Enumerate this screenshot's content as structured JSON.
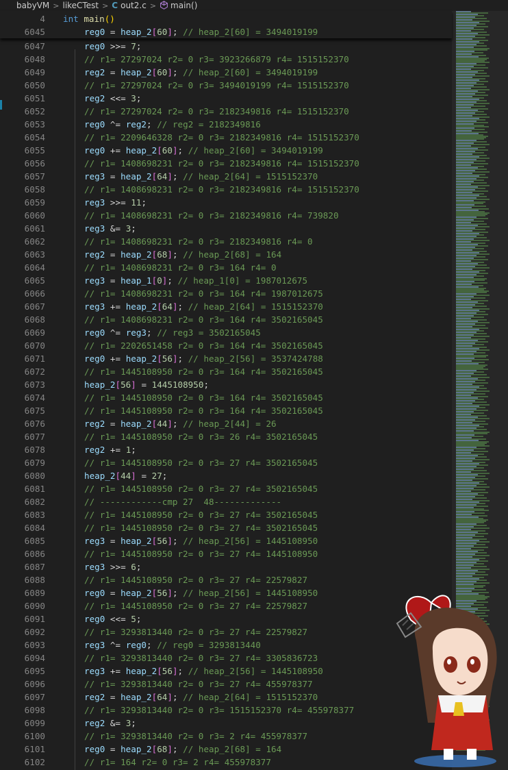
{
  "breadcrumb": {
    "items": [
      "babyVM",
      "likeCTest",
      "out2.c",
      "main()"
    ]
  },
  "sticky": [
    {
      "num": "4",
      "tokens": [
        [
          "kw",
          "int "
        ],
        [
          "fn",
          "main"
        ],
        [
          "br2",
          "()"
        ]
      ]
    },
    {
      "num": "6045",
      "tokens": [
        [
          "var",
          "reg0"
        ],
        [
          "t",
          " = "
        ],
        [
          "var",
          "heap_2"
        ],
        [
          "br",
          "["
        ],
        [
          "num",
          "60"
        ],
        [
          "br",
          "]"
        ],
        [
          "t",
          "; "
        ],
        [
          "cm",
          "// heap_2[60] = 3494019199"
        ]
      ]
    }
  ],
  "lines": [
    {
      "num": "6047",
      "tokens": [
        [
          "var",
          "reg0"
        ],
        [
          "t",
          " >>= "
        ],
        [
          "num",
          "7"
        ],
        [
          "t",
          ";"
        ]
      ]
    },
    {
      "num": "6048",
      "tokens": [
        [
          "cm",
          "// r1= 27297024 r2= 0 r3= 3923266879 r4= 1515152370"
        ]
      ]
    },
    {
      "num": "6049",
      "tokens": [
        [
          "var",
          "reg2"
        ],
        [
          "t",
          " = "
        ],
        [
          "var",
          "heap_2"
        ],
        [
          "br",
          "["
        ],
        [
          "num",
          "60"
        ],
        [
          "br",
          "]"
        ],
        [
          "t",
          "; "
        ],
        [
          "cm",
          "// heap_2[60] = 3494019199"
        ]
      ]
    },
    {
      "num": "6050",
      "tokens": [
        [
          "cm",
          "// r1= 27297024 r2= 0 r3= 3494019199 r4= 1515152370"
        ]
      ]
    },
    {
      "num": "6051",
      "tokens": [
        [
          "var",
          "reg2"
        ],
        [
          "t",
          " <<= "
        ],
        [
          "num",
          "3"
        ],
        [
          "t",
          ";"
        ]
      ]
    },
    {
      "num": "6052",
      "tokens": [
        [
          "cm",
          "// r1= 27297024 r2= 0 r3= 2182349816 r4= 1515152370"
        ]
      ]
    },
    {
      "num": "6053",
      "tokens": [
        [
          "var",
          "reg0"
        ],
        [
          "t",
          " ^= "
        ],
        [
          "var",
          "reg2"
        ],
        [
          "t",
          "; "
        ],
        [
          "cm",
          "// reg2 = 2182349816"
        ]
      ]
    },
    {
      "num": "6054",
      "tokens": [
        [
          "cm",
          "// r1= 2209646328 r2= 0 r3= 2182349816 r4= 1515152370"
        ]
      ]
    },
    {
      "num": "6055",
      "tokens": [
        [
          "var",
          "reg0"
        ],
        [
          "t",
          " += "
        ],
        [
          "var",
          "heap_2"
        ],
        [
          "br",
          "["
        ],
        [
          "num",
          "60"
        ],
        [
          "br",
          "]"
        ],
        [
          "t",
          "; "
        ],
        [
          "cm",
          "// heap_2[60] = 3494019199"
        ]
      ]
    },
    {
      "num": "6056",
      "tokens": [
        [
          "cm",
          "// r1= 1408698231 r2= 0 r3= 2182349816 r4= 1515152370"
        ]
      ]
    },
    {
      "num": "6057",
      "tokens": [
        [
          "var",
          "reg3"
        ],
        [
          "t",
          " = "
        ],
        [
          "var",
          "heap_2"
        ],
        [
          "br",
          "["
        ],
        [
          "num",
          "64"
        ],
        [
          "br",
          "]"
        ],
        [
          "t",
          "; "
        ],
        [
          "cm",
          "// heap_2[64] = 1515152370"
        ]
      ]
    },
    {
      "num": "6058",
      "tokens": [
        [
          "cm",
          "// r1= 1408698231 r2= 0 r3= 2182349816 r4= 1515152370"
        ]
      ]
    },
    {
      "num": "6059",
      "tokens": [
        [
          "var",
          "reg3"
        ],
        [
          "t",
          " >>= "
        ],
        [
          "num",
          "11"
        ],
        [
          "t",
          ";"
        ]
      ]
    },
    {
      "num": "6060",
      "tokens": [
        [
          "cm",
          "// r1= 1408698231 r2= 0 r3= 2182349816 r4= 739820"
        ]
      ]
    },
    {
      "num": "6061",
      "tokens": [
        [
          "var",
          "reg3"
        ],
        [
          "t",
          " &= "
        ],
        [
          "num",
          "3"
        ],
        [
          "t",
          ";"
        ]
      ]
    },
    {
      "num": "6062",
      "tokens": [
        [
          "cm",
          "// r1= 1408698231 r2= 0 r3= 2182349816 r4= 0"
        ]
      ]
    },
    {
      "num": "6063",
      "tokens": [
        [
          "var",
          "reg2"
        ],
        [
          "t",
          " = "
        ],
        [
          "var",
          "heap_2"
        ],
        [
          "br",
          "["
        ],
        [
          "num",
          "68"
        ],
        [
          "br",
          "]"
        ],
        [
          "t",
          "; "
        ],
        [
          "cm",
          "// heap_2[68] = 164"
        ]
      ]
    },
    {
      "num": "6064",
      "tokens": [
        [
          "cm",
          "// r1= 1408698231 r2= 0 r3= 164 r4= 0"
        ]
      ]
    },
    {
      "num": "6065",
      "tokens": [
        [
          "var",
          "reg3"
        ],
        [
          "t",
          " = "
        ],
        [
          "var",
          "heap_1"
        ],
        [
          "br",
          "["
        ],
        [
          "num",
          "0"
        ],
        [
          "br",
          "]"
        ],
        [
          "t",
          "; "
        ],
        [
          "cm",
          "// heap_1[0] = 1987012675"
        ]
      ]
    },
    {
      "num": "6066",
      "tokens": [
        [
          "cm",
          "// r1= 1408698231 r2= 0 r3= 164 r4= 1987012675"
        ]
      ]
    },
    {
      "num": "6067",
      "tokens": [
        [
          "var",
          "reg3"
        ],
        [
          "t",
          " += "
        ],
        [
          "var",
          "heap_2"
        ],
        [
          "br",
          "["
        ],
        [
          "num",
          "64"
        ],
        [
          "br",
          "]"
        ],
        [
          "t",
          "; "
        ],
        [
          "cm",
          "// heap_2[64] = 1515152370"
        ]
      ]
    },
    {
      "num": "6068",
      "tokens": [
        [
          "cm",
          "// r1= 1408698231 r2= 0 r3= 164 r4= 3502165045"
        ]
      ]
    },
    {
      "num": "6069",
      "tokens": [
        [
          "var",
          "reg0"
        ],
        [
          "t",
          " ^= "
        ],
        [
          "var",
          "reg3"
        ],
        [
          "t",
          "; "
        ],
        [
          "cm",
          "// reg3 = 3502165045"
        ]
      ]
    },
    {
      "num": "6070",
      "tokens": [
        [
          "cm",
          "// r1= 2202651458 r2= 0 r3= 164 r4= 3502165045"
        ]
      ]
    },
    {
      "num": "6071",
      "tokens": [
        [
          "var",
          "reg0"
        ],
        [
          "t",
          " += "
        ],
        [
          "var",
          "heap_2"
        ],
        [
          "br",
          "["
        ],
        [
          "num",
          "56"
        ],
        [
          "br",
          "]"
        ],
        [
          "t",
          "; "
        ],
        [
          "cm",
          "// heap_2[56] = 3537424788"
        ]
      ]
    },
    {
      "num": "6072",
      "tokens": [
        [
          "cm",
          "// r1= 1445108950 r2= 0 r3= 164 r4= 3502165045"
        ]
      ]
    },
    {
      "num": "6073",
      "tokens": [
        [
          "var",
          "heap_2"
        ],
        [
          "br",
          "["
        ],
        [
          "num",
          "56"
        ],
        [
          "br",
          "]"
        ],
        [
          "t",
          " = "
        ],
        [
          "num",
          "1445108950"
        ],
        [
          "t",
          ";"
        ]
      ]
    },
    {
      "num": "6074",
      "tokens": [
        [
          "cm",
          "// r1= 1445108950 r2= 0 r3= 164 r4= 3502165045"
        ]
      ]
    },
    {
      "num": "6075",
      "tokens": [
        [
          "cm",
          "// r1= 1445108950 r2= 0 r3= 164 r4= 3502165045"
        ]
      ]
    },
    {
      "num": "6076",
      "tokens": [
        [
          "var",
          "reg2"
        ],
        [
          "t",
          " = "
        ],
        [
          "var",
          "heap_2"
        ],
        [
          "br",
          "["
        ],
        [
          "num",
          "44"
        ],
        [
          "br",
          "]"
        ],
        [
          "t",
          "; "
        ],
        [
          "cm",
          "// heap_2[44] = 26"
        ]
      ]
    },
    {
      "num": "6077",
      "tokens": [
        [
          "cm",
          "// r1= 1445108950 r2= 0 r3= 26 r4= 3502165045"
        ]
      ]
    },
    {
      "num": "6078",
      "tokens": [
        [
          "var",
          "reg2"
        ],
        [
          "t",
          " += "
        ],
        [
          "num",
          "1"
        ],
        [
          "t",
          ";"
        ]
      ]
    },
    {
      "num": "6079",
      "tokens": [
        [
          "cm",
          "// r1= 1445108950 r2= 0 r3= 27 r4= 3502165045"
        ]
      ]
    },
    {
      "num": "6080",
      "tokens": [
        [
          "var",
          "heap_2"
        ],
        [
          "br",
          "["
        ],
        [
          "num",
          "44"
        ],
        [
          "br",
          "]"
        ],
        [
          "t",
          " = "
        ],
        [
          "num",
          "27"
        ],
        [
          "t",
          ";"
        ]
      ]
    },
    {
      "num": "6081",
      "tokens": [
        [
          "cm",
          "// r1= 1445108950 r2= 0 r3= 27 r4= 3502165045"
        ]
      ]
    },
    {
      "num": "6082",
      "tokens": [
        [
          "cm",
          "// ------------cmp 27  48-------------"
        ]
      ]
    },
    {
      "num": "6083",
      "tokens": [
        [
          "cm",
          "// r1= 1445108950 r2= 0 r3= 27 r4= 3502165045"
        ]
      ]
    },
    {
      "num": "6084",
      "tokens": [
        [
          "cm",
          "// r1= 1445108950 r2= 0 r3= 27 r4= 3502165045"
        ]
      ]
    },
    {
      "num": "6085",
      "tokens": [
        [
          "var",
          "reg3"
        ],
        [
          "t",
          " = "
        ],
        [
          "var",
          "heap_2"
        ],
        [
          "br",
          "["
        ],
        [
          "num",
          "56"
        ],
        [
          "br",
          "]"
        ],
        [
          "t",
          "; "
        ],
        [
          "cm",
          "// heap_2[56] = 1445108950"
        ]
      ]
    },
    {
      "num": "6086",
      "tokens": [
        [
          "cm",
          "// r1= 1445108950 r2= 0 r3= 27 r4= 1445108950"
        ]
      ]
    },
    {
      "num": "6087",
      "tokens": [
        [
          "var",
          "reg3"
        ],
        [
          "t",
          " >>= "
        ],
        [
          "num",
          "6"
        ],
        [
          "t",
          ";"
        ]
      ]
    },
    {
      "num": "6088",
      "tokens": [
        [
          "cm",
          "// r1= 1445108950 r2= 0 r3= 27 r4= 22579827"
        ]
      ]
    },
    {
      "num": "6089",
      "tokens": [
        [
          "var",
          "reg0"
        ],
        [
          "t",
          " = "
        ],
        [
          "var",
          "heap_2"
        ],
        [
          "br",
          "["
        ],
        [
          "num",
          "56"
        ],
        [
          "br",
          "]"
        ],
        [
          "t",
          "; "
        ],
        [
          "cm",
          "// heap_2[56] = 1445108950"
        ]
      ]
    },
    {
      "num": "6090",
      "tokens": [
        [
          "cm",
          "// r1= 1445108950 r2= 0 r3= 27 r4= 22579827"
        ]
      ]
    },
    {
      "num": "6091",
      "tokens": [
        [
          "var",
          "reg0"
        ],
        [
          "t",
          " <<= "
        ],
        [
          "num",
          "5"
        ],
        [
          "t",
          ";"
        ]
      ]
    },
    {
      "num": "6092",
      "tokens": [
        [
          "cm",
          "// r1= 3293813440 r2= 0 r3= 27 r4= 22579827"
        ]
      ]
    },
    {
      "num": "6093",
      "tokens": [
        [
          "var",
          "reg3"
        ],
        [
          "t",
          " ^= "
        ],
        [
          "var",
          "reg0"
        ],
        [
          "t",
          "; "
        ],
        [
          "cm",
          "// reg0 = 3293813440"
        ]
      ]
    },
    {
      "num": "6094",
      "tokens": [
        [
          "cm",
          "// r1= 3293813440 r2= 0 r3= 27 r4= 3305836723"
        ]
      ]
    },
    {
      "num": "6095",
      "tokens": [
        [
          "var",
          "reg3"
        ],
        [
          "t",
          " += "
        ],
        [
          "var",
          "heap_2"
        ],
        [
          "br",
          "["
        ],
        [
          "num",
          "56"
        ],
        [
          "br",
          "]"
        ],
        [
          "t",
          "; "
        ],
        [
          "cm",
          "// heap_2[56] = 1445108950"
        ]
      ]
    },
    {
      "num": "6096",
      "tokens": [
        [
          "cm",
          "// r1= 3293813440 r2= 0 r3= 27 r4= 455978377"
        ]
      ]
    },
    {
      "num": "6097",
      "tokens": [
        [
          "var",
          "reg2"
        ],
        [
          "t",
          " = "
        ],
        [
          "var",
          "heap_2"
        ],
        [
          "br",
          "["
        ],
        [
          "num",
          "64"
        ],
        [
          "br",
          "]"
        ],
        [
          "t",
          "; "
        ],
        [
          "cm",
          "// heap_2[64] = 1515152370"
        ]
      ]
    },
    {
      "num": "6098",
      "tokens": [
        [
          "cm",
          "// r1= 3293813440 r2= 0 r3= 1515152370 r4= 455978377"
        ]
      ]
    },
    {
      "num": "6099",
      "tokens": [
        [
          "var",
          "reg2"
        ],
        [
          "t",
          " &= "
        ],
        [
          "num",
          "3"
        ],
        [
          "t",
          ";"
        ]
      ]
    },
    {
      "num": "6100",
      "tokens": [
        [
          "cm",
          "// r1= 3293813440 r2= 0 r3= 2 r4= 455978377"
        ]
      ]
    },
    {
      "num": "6101",
      "tokens": [
        [
          "var",
          "reg0"
        ],
        [
          "t",
          " = "
        ],
        [
          "var",
          "heap_2"
        ],
        [
          "br",
          "["
        ],
        [
          "num",
          "68"
        ],
        [
          "br",
          "]"
        ],
        [
          "t",
          "; "
        ],
        [
          "cm",
          "// heap_2[68] = 164"
        ]
      ]
    },
    {
      "num": "6102",
      "tokens": [
        [
          "cm",
          "// r1= 164 r2= 0 r3= 2 r4= 455978377"
        ]
      ]
    }
  ],
  "icons": {
    "file_type": "c-language-icon",
    "symbol": "cube-method-icon"
  }
}
